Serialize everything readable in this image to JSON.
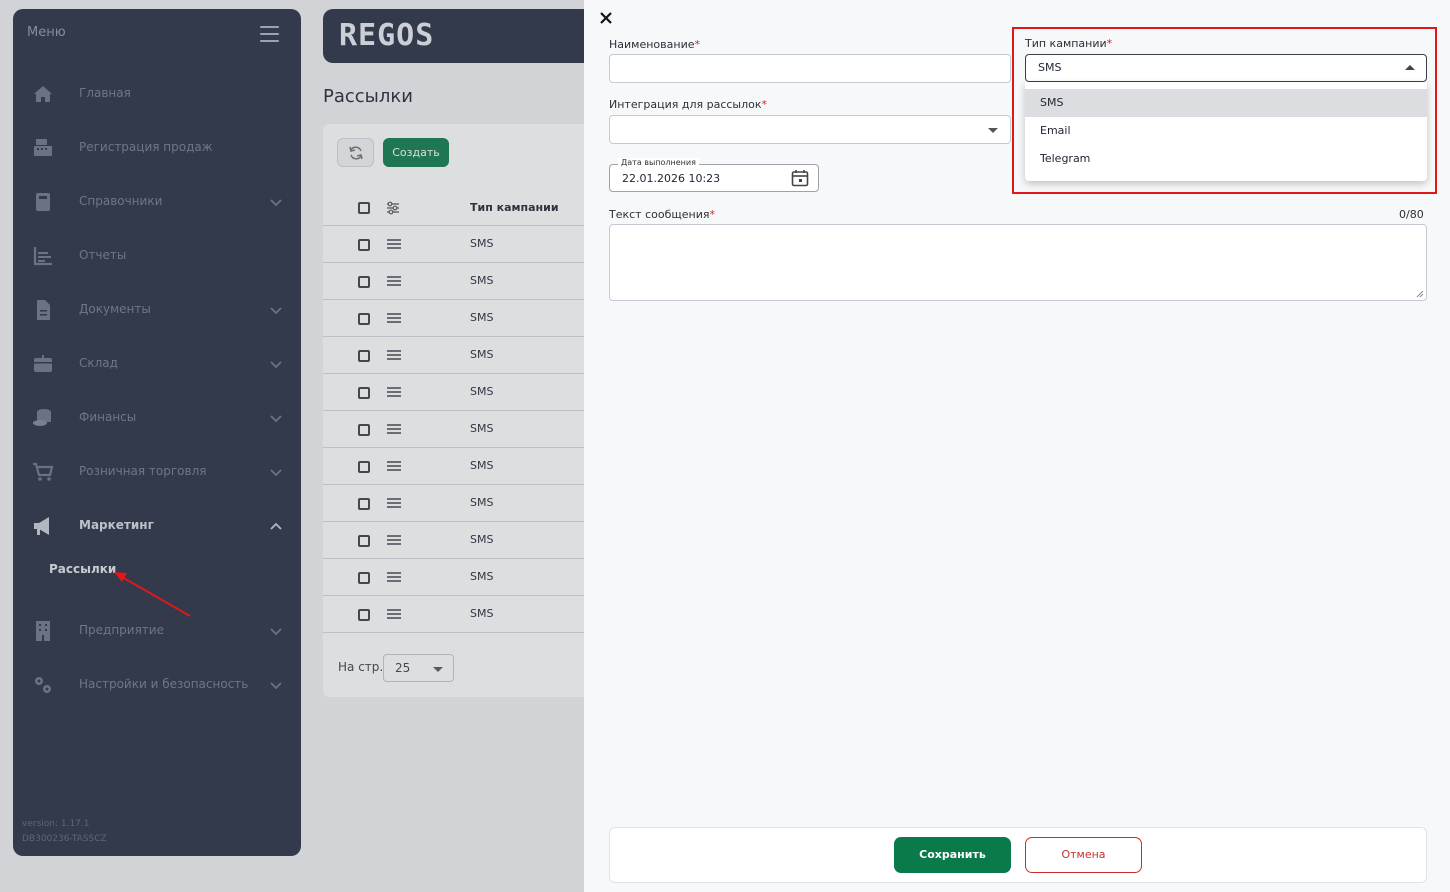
{
  "sidebar": {
    "title": "Меню",
    "items": [
      {
        "label": "Главная",
        "icon": "home-icon",
        "chevron": ""
      },
      {
        "label": "Регистрация продаж",
        "icon": "cash-register-icon",
        "chevron": ""
      },
      {
        "label": "Справочники",
        "icon": "book-icon",
        "chevron": "down"
      },
      {
        "label": "Отчеты",
        "icon": "chart-icon",
        "chevron": ""
      },
      {
        "label": "Документы",
        "icon": "document-icon",
        "chevron": "down"
      },
      {
        "label": "Склад",
        "icon": "box-icon",
        "chevron": "down"
      },
      {
        "label": "Финансы",
        "icon": "coins-icon",
        "chevron": "down"
      },
      {
        "label": "Розничная торговля",
        "icon": "cart-icon",
        "chevron": "down"
      },
      {
        "label": "Маркетинг",
        "icon": "megaphone-icon",
        "chevron": "up"
      },
      {
        "label": "Предприятие",
        "icon": "building-icon",
        "chevron": "down"
      },
      {
        "label": "Настройки и безопасность",
        "icon": "gears-icon",
        "chevron": "down"
      }
    ],
    "sub_item": "Рассылки",
    "version": "version: 1.17.1",
    "db": "DB300236-TASSCZ"
  },
  "logo": "REGOS",
  "page": {
    "title": "Рассылки",
    "create_label": "Создать",
    "column_header": "Тип кампании",
    "rows": [
      "SMS",
      "SMS",
      "SMS",
      "SMS",
      "SMS",
      "SMS",
      "SMS",
      "SMS",
      "SMS",
      "SMS",
      "SMS"
    ],
    "per_page_label": "На стр.",
    "per_page_value": "25"
  },
  "drawer": {
    "name_label": "Наименование",
    "integration_label": "Интеграция для рассылок",
    "date_label": "Дата выполнения",
    "date_value": "22.01.2026 10:23",
    "message_label": "Текст сообщения",
    "counter": "0/80",
    "campaign_type_label": "Тип кампании",
    "campaign_type_value": "SMS",
    "options": [
      "SMS",
      "Email",
      "Telegram"
    ],
    "required_mark": "*",
    "save_label": "Сохранить",
    "cancel_label": "Отмена"
  },
  "colors": {
    "sidebar_bg": "#252d40",
    "accent_green": "#0b7a4b",
    "cancel_red": "#c62f2f",
    "highlight_red": "#e01818"
  }
}
